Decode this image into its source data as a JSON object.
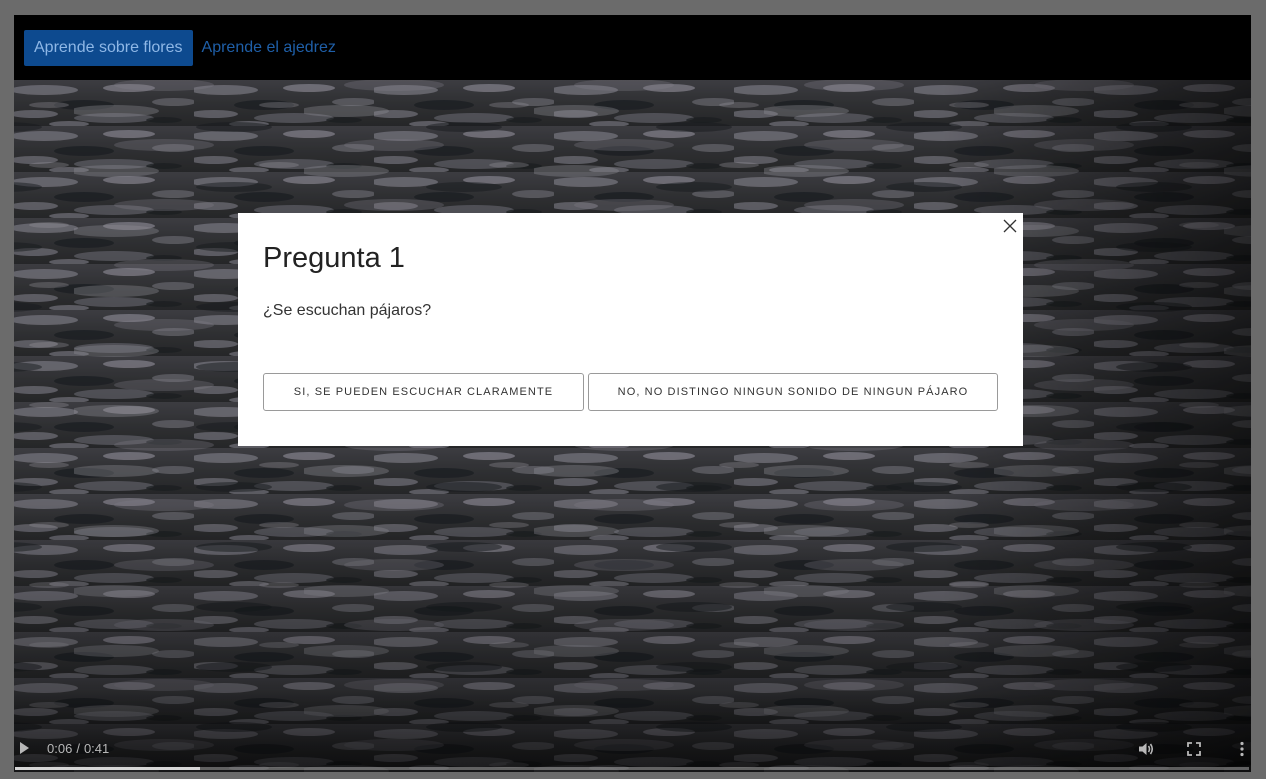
{
  "nav": {
    "tabs": [
      {
        "label": "Aprende sobre flores",
        "active": true
      },
      {
        "label": "Aprende el ajedrez",
        "active": false
      }
    ]
  },
  "video": {
    "current_time": "0:06",
    "separator": "/",
    "duration": "0:41",
    "progress_fraction": 0.15,
    "icons": [
      "play-icon",
      "volume-icon",
      "fullscreen-icon",
      "more-options-icon"
    ]
  },
  "modal": {
    "title": "Pregunta 1",
    "question": "¿Se escuchan pájaros?",
    "answers": [
      {
        "label": "SI, SE PUEDEN ESCUCHAR CLARAMENTE"
      },
      {
        "label": "NO, NO DISTINGO NINGUN SONIDO DE NINGUN PÁJARO"
      }
    ],
    "close_icon": "close-icon"
  },
  "colors": {
    "page_background": "#6b6b6b",
    "active_tab_bg": "#0d4a8f",
    "active_tab_text": "#8eb7e6",
    "inactive_tab_text": "#1f5fa8",
    "modal_bg": "#ffffff"
  }
}
